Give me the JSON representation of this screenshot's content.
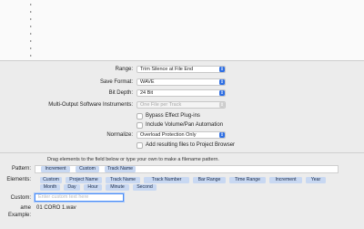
{
  "form": {
    "range": {
      "label": "Range:",
      "value": "Trim Silence at File End"
    },
    "save_format": {
      "label": "Save Format:",
      "value": "WAVE"
    },
    "bit_depth": {
      "label": "Bit Depth:",
      "value": "24 Bit"
    },
    "multi_output": {
      "label": "Multi-Output Software Instruments:",
      "value": "One File per Track"
    },
    "bypass": {
      "label": "Bypass Effect Plug-ins",
      "checked": false
    },
    "volpan": {
      "label": "Include Volume/Pan Automation",
      "checked": false
    },
    "normalize": {
      "label": "Normalize:",
      "value": "Overload Protection Only"
    },
    "add_browser": {
      "label": "Add resulting files to Project Browser",
      "checked": false
    }
  },
  "pattern": {
    "hint": "Drag elements to the field below or type your own to make a filename pattern.",
    "label": "Pattern:",
    "tokens": [
      "Increment",
      "Custom",
      "Track Name"
    ]
  },
  "elements": {
    "label": "Elements:",
    "row1": [
      "Custom",
      "Project Name",
      "Track Name",
      "Track Number",
      "Bar Range",
      "Time Range",
      "Increment",
      "Year"
    ],
    "row2": [
      "Month",
      "Day",
      "Hour",
      "Minute",
      "Second"
    ]
  },
  "custom": {
    "label": "Custom:",
    "placeholder": "Enter custom text here"
  },
  "example": {
    "label": "ame Example:",
    "value": "01  CORO 1.wav"
  },
  "colors": {
    "accent": "#2f6fe3",
    "token_bg": "#c8d8f2",
    "focus": "#4d8ef5"
  }
}
